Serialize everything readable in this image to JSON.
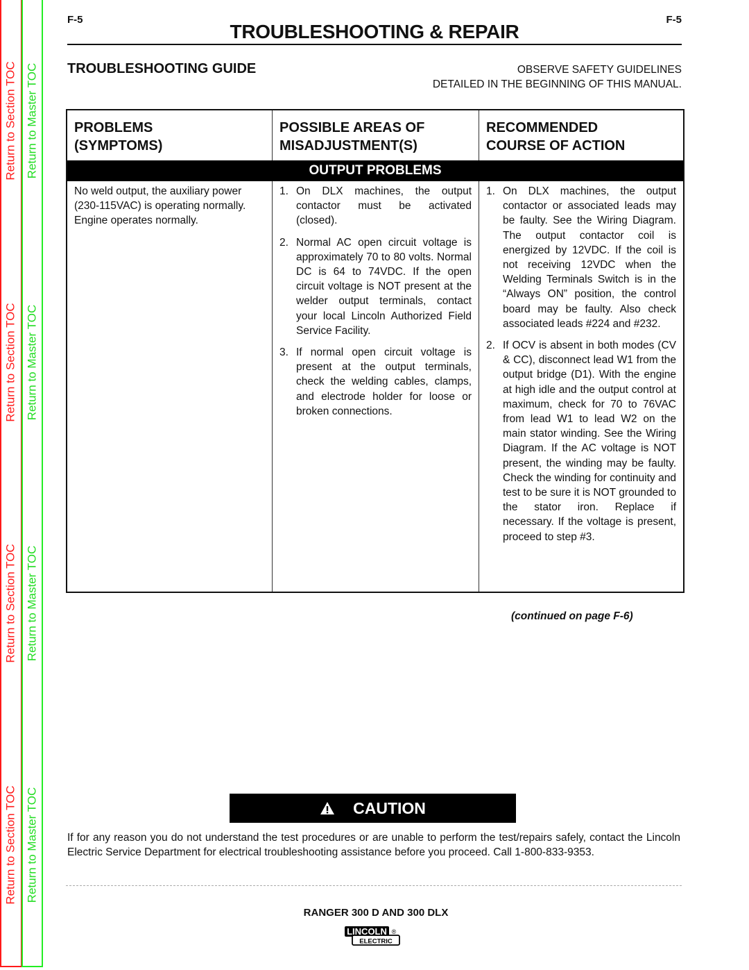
{
  "toc": {
    "section_label": "Return to Section TOC",
    "master_label": "Return to Master TOC",
    "section_color": "#ff1a1a",
    "master_color": "#22dd22"
  },
  "header": {
    "page_code_left": "F-5",
    "page_code_right": "F-5",
    "title": "TROUBLESHOOTING & REPAIR",
    "guide_title": "TROUBLESHOOTING GUIDE",
    "safety_line1": "OBSERVE SAFETY GUIDELINES",
    "safety_line2": "DETAILED IN THE BEGINNING OF THIS MANUAL."
  },
  "table": {
    "headers": [
      {
        "line1": "PROBLEMS",
        "line2": "(SYMPTOMS)"
      },
      {
        "line1": "POSSIBLE AREAS OF",
        "line2": "MISADJUSTMENT(S)"
      },
      {
        "line1": "RECOMMENDED",
        "line2": "COURSE OF ACTION"
      }
    ],
    "section_title": "OUTPUT PROBLEMS",
    "symptom": "No weld output, the auxiliary power (230-115VAC) is operating normally. Engine operates normally.",
    "misadjustments": [
      {
        "num": "1.",
        "text": "On DLX machines, the output contactor must be activated (closed)."
      },
      {
        "num": "2.",
        "text": "Normal AC open circuit voltage is approximately 70 to 80 volts. Normal DC is 64 to 74VDC.  If the open circuit voltage is NOT present at the welder output terminals, contact your local Lincoln Authorized Field Service Facility."
      },
      {
        "num": "3.",
        "text": "If normal open circuit voltage is present at the output terminals, check the welding cables, clamps, and electrode holder for loose or broken connections."
      }
    ],
    "actions": [
      {
        "num": "1.",
        "text": "On DLX machines, the output contactor or associated leads may be faulty.  See the Wiring Diagram.  The output contactor coil is energized by 12VDC.  If the coil is not receiving 12VDC when the Welding Terminals Switch is in the “Always ON” position, the control board may be faulty.  Also check associated leads #224 and #232."
      },
      {
        "num": "2.",
        "text": "If OCV is absent in both modes (CV & CC), disconnect lead W1 from the output bridge (D1). With the engine at high idle and the output control at maximum, check for 70 to 76VAC from lead W1 to lead W2 on the main stator winding.  See the Wiring Diagram.  If the AC voltage is NOT present, the winding may be faulty.  Check the winding for continuity and test to be sure it is NOT grounded to the stator iron.  Replace if necessary.  If the voltage is present, proceed to step #3."
      }
    ]
  },
  "continued": "(continued on page F-6)",
  "caution": {
    "icon": "warning-triangle-icon",
    "label": "CAUTION",
    "text": "If for any reason you do not understand the test procedures or are unable to perform the test/repairs safely, contact the Lincoln Electric Service Department for electrical troubleshooting assistance before you proceed.  Call 1-800-833-9353."
  },
  "footer": {
    "model": "RANGER 300 D AND 300 DLX",
    "logo_top": "LINCOLN",
    "logo_bottom": "ELECTRIC",
    "logo_mark": "®"
  }
}
